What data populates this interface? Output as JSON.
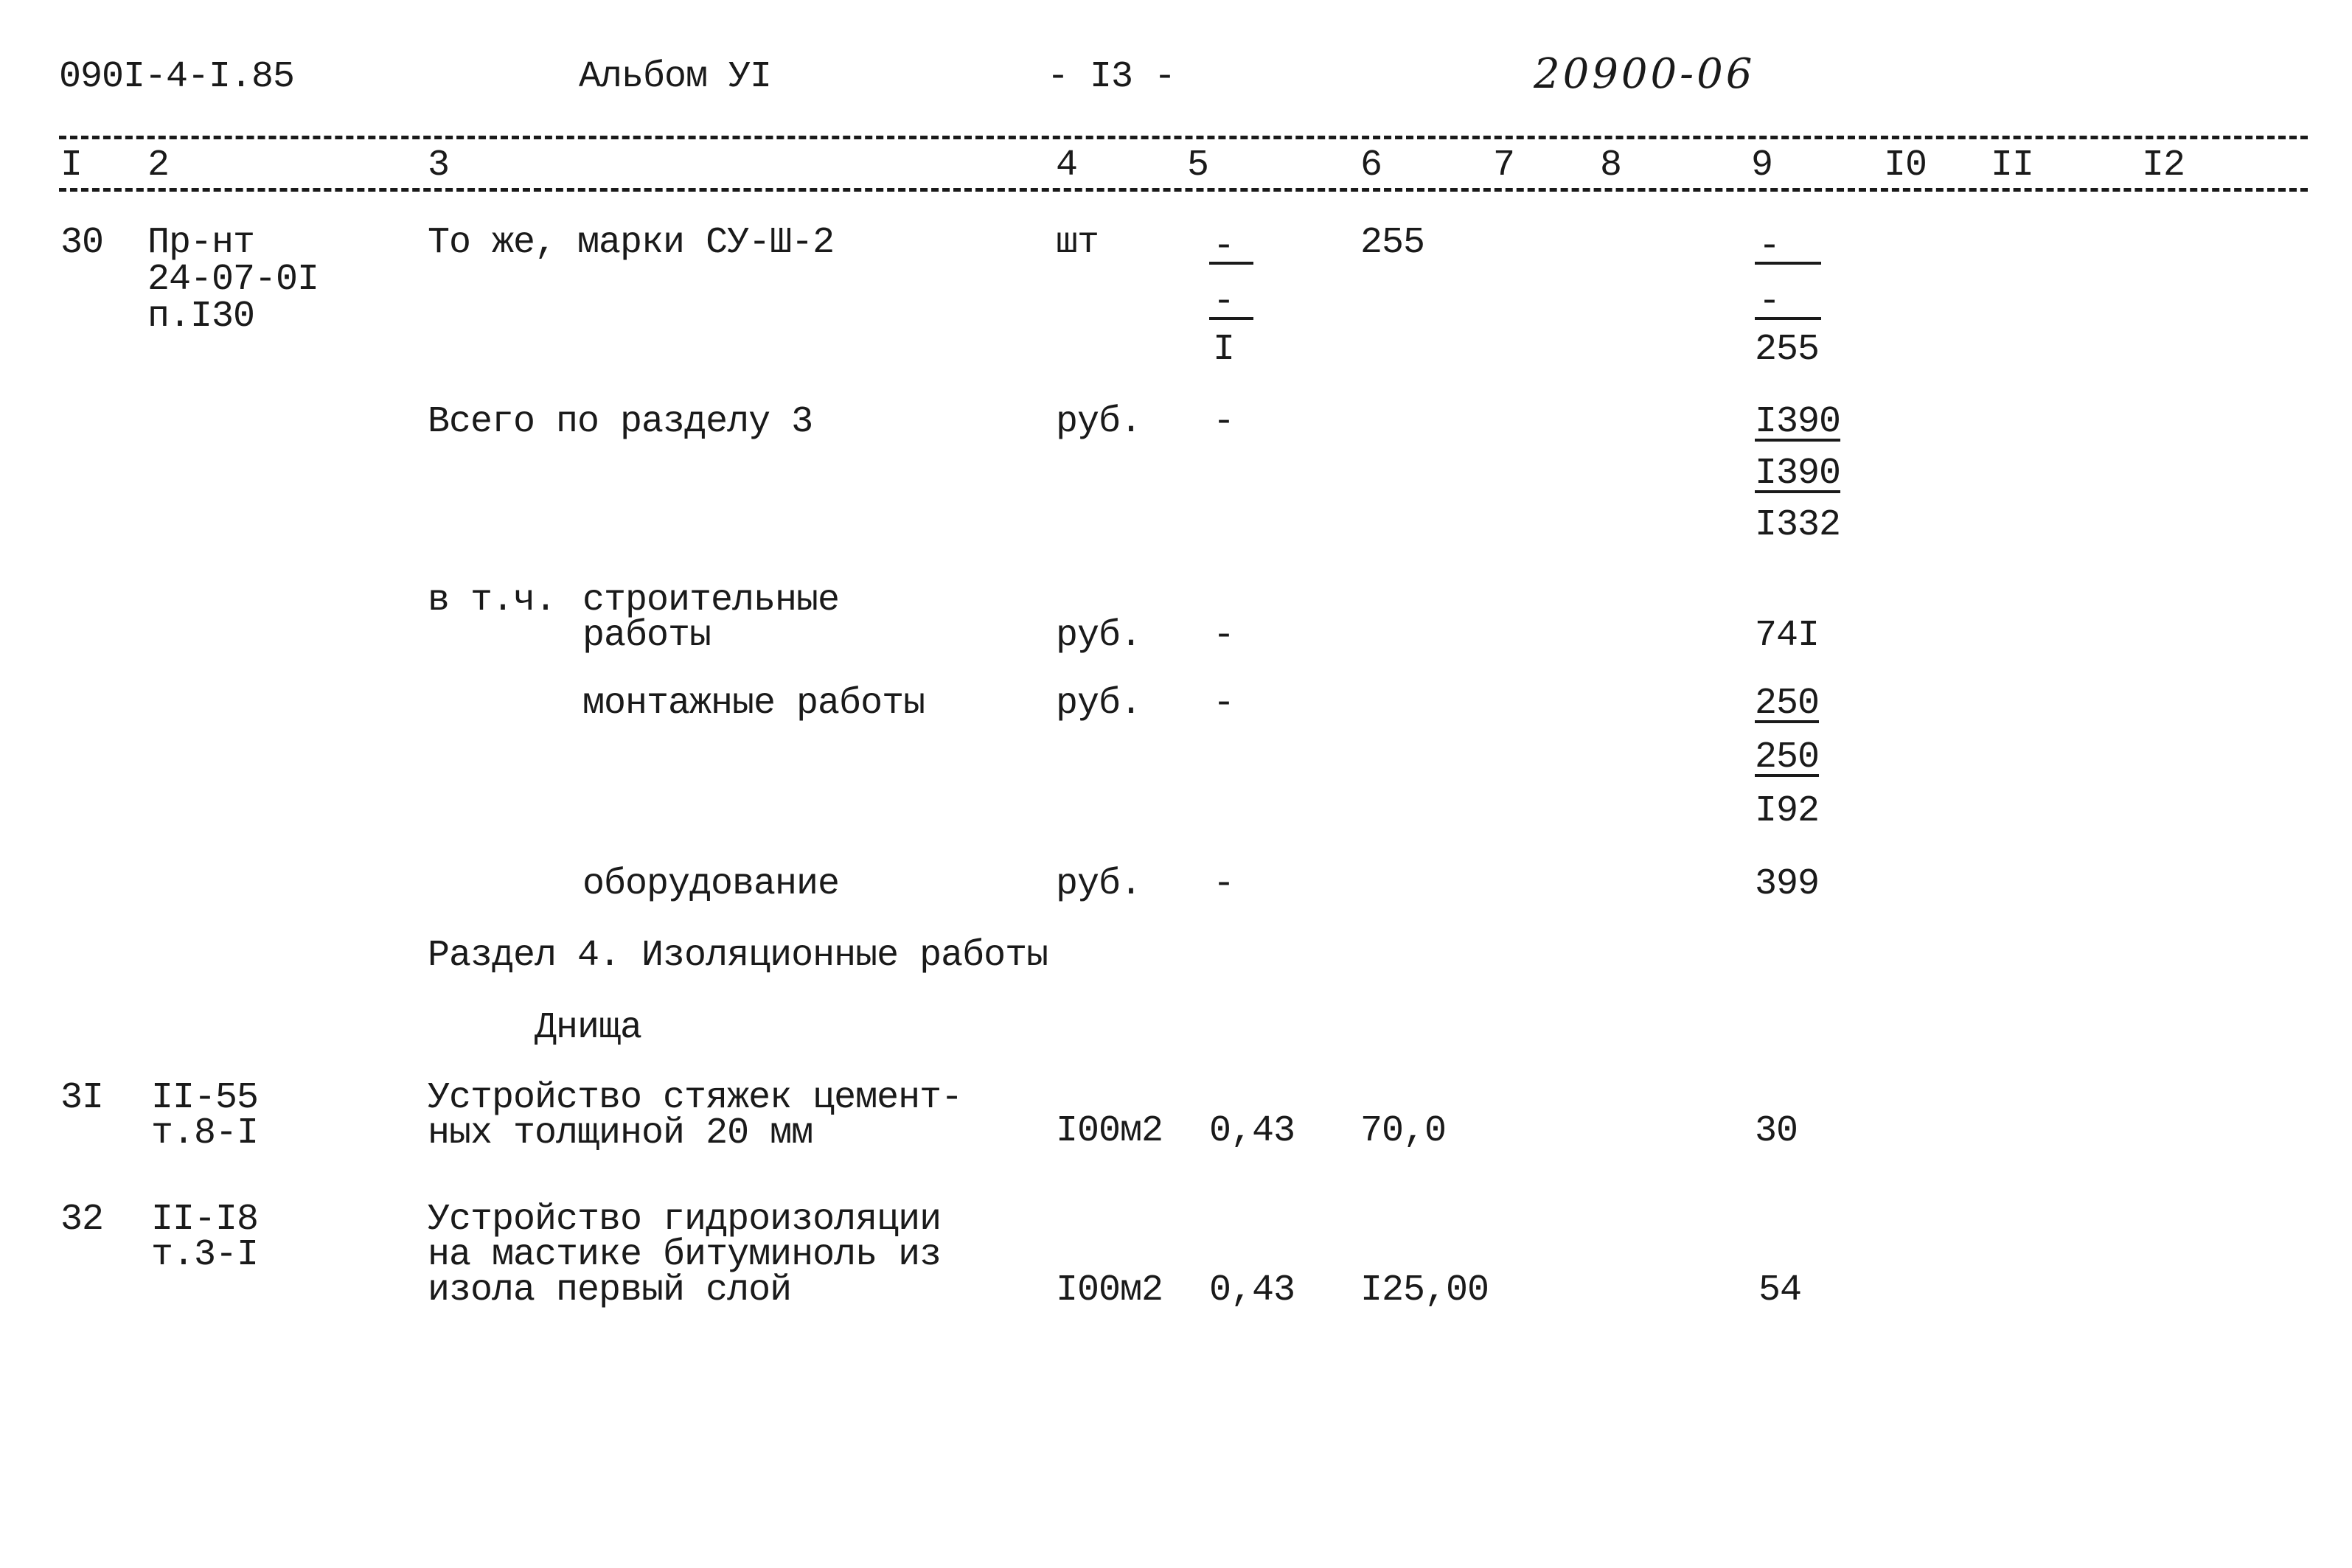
{
  "header": {
    "doc_code": "090I-4-I.85",
    "album": "Альбом УI",
    "page": "- I3 -",
    "handwritten_number": "20900-06"
  },
  "columns": [
    "I",
    "2",
    "3",
    "4",
    "5",
    "6",
    "7",
    "8",
    "9",
    "I0",
    "II",
    "I2"
  ],
  "rows": [
    {
      "num": "30",
      "ref": [
        "Пр-нт",
        "24-07-0I",
        "п.I30"
      ],
      "desc": "То же, марки СУ-Ш-2",
      "unit": "шт",
      "col5": [
        "-",
        "-",
        "I"
      ],
      "col6": "255",
      "col9": [
        "-",
        "-",
        "255"
      ]
    },
    {
      "desc": "Всего по разделу 3",
      "unit": "руб.",
      "col5": "-",
      "col9": [
        "I390",
        "I390",
        "I332"
      ]
    },
    {
      "desc_prefix": "в т.ч.",
      "desc": [
        "строительные",
        "работы"
      ],
      "unit": "руб.",
      "col5": "-",
      "col9": "74I"
    },
    {
      "desc": "монтажные работы",
      "unit": "руб.",
      "col5": "-",
      "col9": [
        "250",
        "250",
        "I92"
      ]
    },
    {
      "desc": "оборудование",
      "unit": "руб.",
      "col5": "-",
      "col9": "399"
    }
  ],
  "section4": {
    "title": "Раздел 4. Изоляционные работы",
    "subtitle": "Днища",
    "items": [
      {
        "num": "3I",
        "ref": [
          "II-55",
          "т.8-I"
        ],
        "desc": [
          "Устройство стяжек цемент-",
          "ных толщиной 20 мм"
        ],
        "unit": "I00м2",
        "qty": "0,43",
        "price": "70,0",
        "total": "30"
      },
      {
        "num": "32",
        "ref": [
          "II-I8",
          "т.3-I"
        ],
        "desc": [
          "Устройство гидроизоляции",
          "на мастике битуминоль из",
          "изола первый слой"
        ],
        "unit": "I00м2",
        "qty": "0,43",
        "price": "I25,00",
        "total": "54"
      }
    ]
  }
}
